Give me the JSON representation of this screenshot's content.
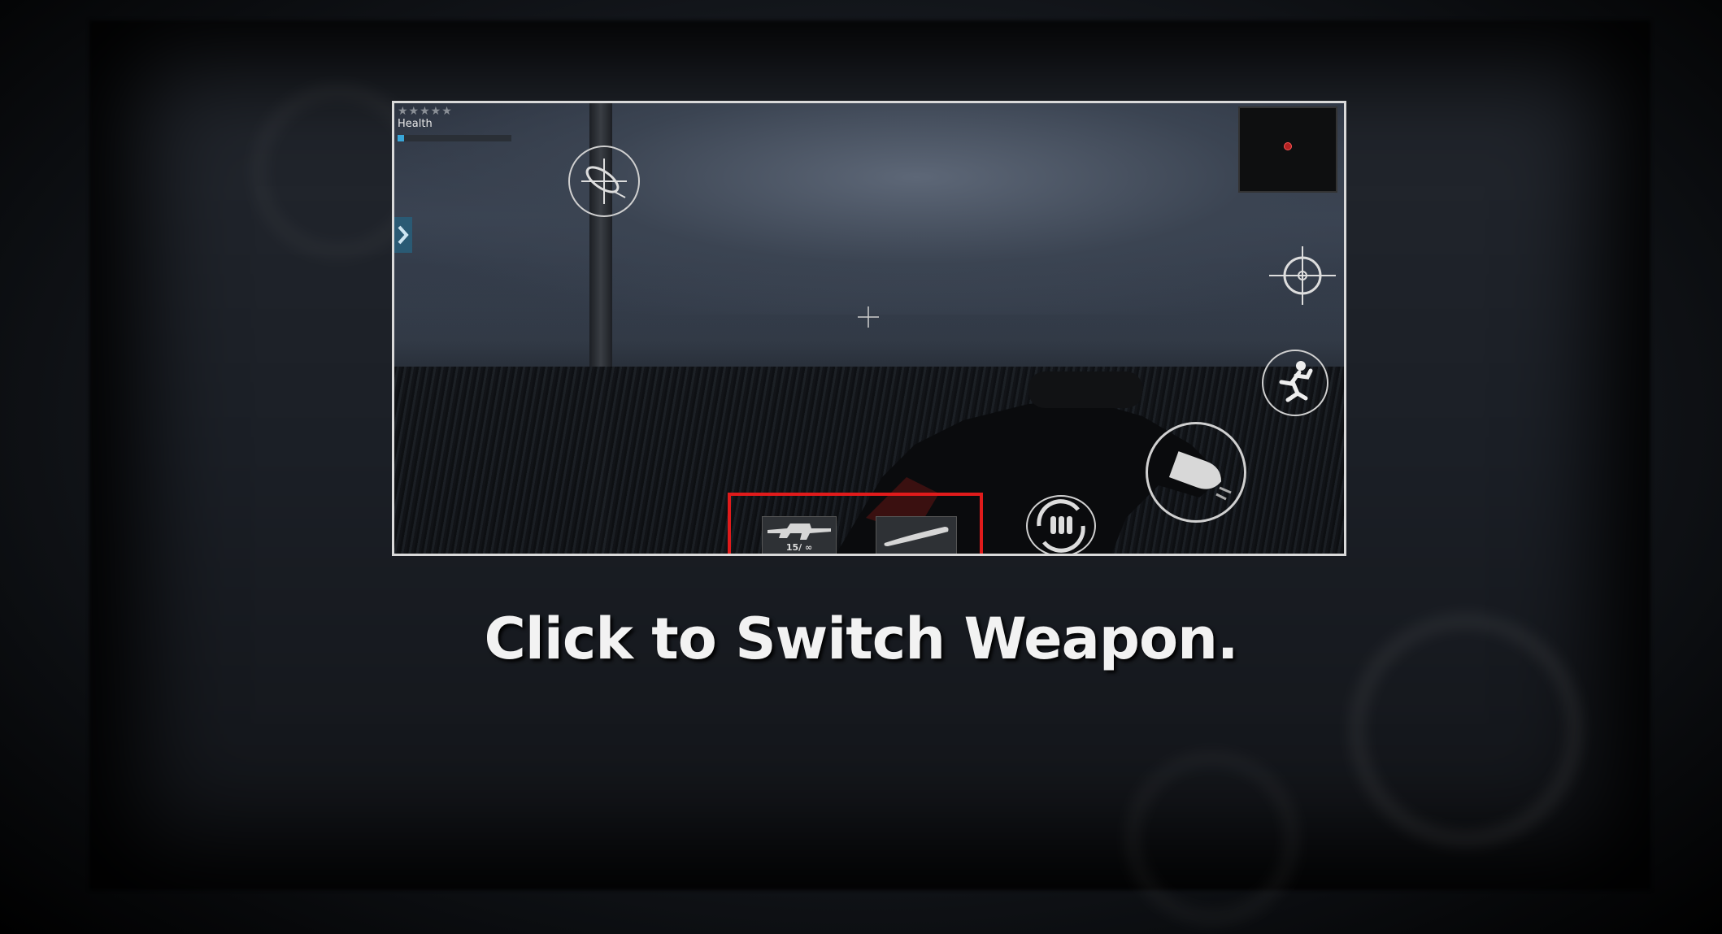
{
  "hud": {
    "stars": "★★★★★",
    "health_label": "Health",
    "health_fraction": 0.06
  },
  "weapon_bar": {
    "primary_ammo": "15/ ∞"
  },
  "caption": "Click to Switch Weapon.",
  "colors": {
    "highlight": "#e01b1b",
    "health": "#39a6d8"
  }
}
